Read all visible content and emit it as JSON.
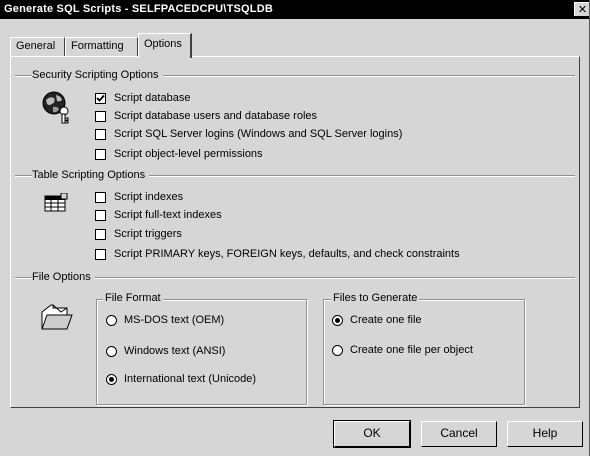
{
  "window": {
    "title": "Generate SQL Scripts - SELFPACEDCPU\\TSQLDB",
    "close_glyph": "✕"
  },
  "tabs": [
    {
      "label": "General",
      "active": false
    },
    {
      "label": "Formatting",
      "active": false
    },
    {
      "label": "Options",
      "active": true
    }
  ],
  "security": {
    "title": "Security Scripting Options",
    "icon": "globe-key-icon",
    "options": [
      {
        "label": "Script database",
        "checked": true
      },
      {
        "label": "Script database users and database roles",
        "checked": false
      },
      {
        "label": "Script SQL Server logins (Windows and SQL Server logins)",
        "checked": false
      },
      {
        "label": "Script object-level permissions",
        "checked": false
      }
    ]
  },
  "table": {
    "title": "Table Scripting Options",
    "icon": "table-grid-icon",
    "options": [
      {
        "label": "Script indexes",
        "checked": false
      },
      {
        "label": "Script full-text indexes",
        "checked": false
      },
      {
        "label": "Script triggers",
        "checked": false
      },
      {
        "label": "Script PRIMARY keys, FOREIGN keys, defaults, and check constraints",
        "checked": false
      }
    ]
  },
  "file": {
    "title": "File Options",
    "icon": "open-folder-icon",
    "format": {
      "title": "File Format",
      "options": [
        {
          "label": "MS-DOS text (OEM)",
          "selected": false
        },
        {
          "label": "Windows text (ANSI)",
          "selected": false
        },
        {
          "label": "International text (Unicode)",
          "selected": true
        }
      ]
    },
    "generate": {
      "title": "Files to Generate",
      "options": [
        {
          "label": "Create one file",
          "selected": true
        },
        {
          "label": "Create one file per object",
          "selected": false
        }
      ]
    }
  },
  "buttons": {
    "ok": "OK",
    "cancel": "Cancel",
    "help": "Help"
  }
}
